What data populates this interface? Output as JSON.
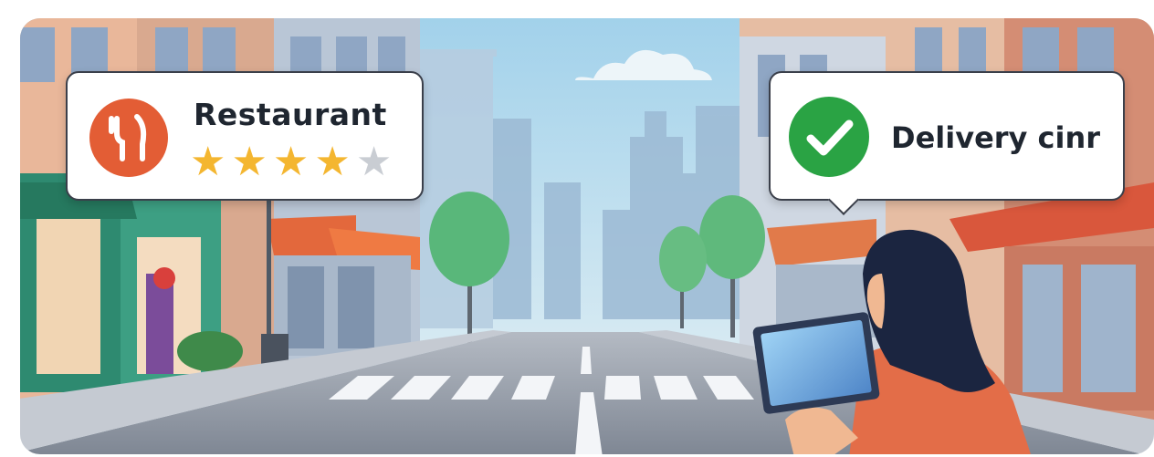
{
  "restaurant_card": {
    "title": "Restaurant",
    "rating": 4,
    "max_rating": 5,
    "icon": "fork-knife-icon",
    "icon_color": "#e35d35"
  },
  "delivery_card": {
    "title": "Delivery cinr",
    "icon": "checkmark-icon",
    "icon_color": "#2aa344"
  },
  "colors": {
    "star_filled": "#f4b630",
    "star_empty": "#c9cdd3",
    "sky": "#bfe0ef",
    "road": "#9ba2ae",
    "jacket": "#e36d48",
    "hair": "#1b2540"
  }
}
